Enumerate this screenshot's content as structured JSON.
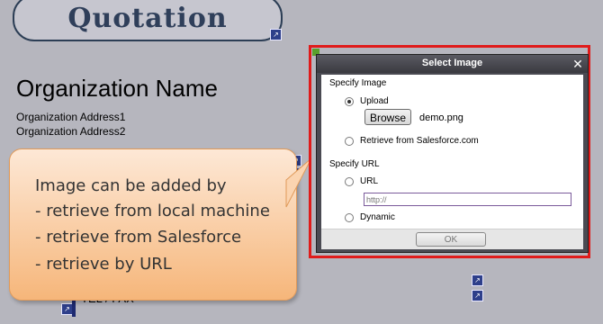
{
  "document": {
    "title": "Quotation",
    "org_name": "Organization Name",
    "org_address_1": "Organization Address1",
    "org_address_2": "Organization Address2",
    "tel_fax": "TEL / FAX"
  },
  "callout": {
    "lines": [
      "Image can be added by",
      "- retrieve from local machine",
      "- retrieve from Salesforce",
      "- retrieve by URL"
    ]
  },
  "dialog": {
    "title": "Select Image",
    "close_glyph": "✕",
    "specify_image_label": "Specify Image",
    "upload_label": "Upload",
    "browse_label": "Browse",
    "file_name": "demo.png",
    "retrieve_sf_label": "Retrieve from Salesforce.com",
    "specify_url_label": "Specify URL",
    "url_label": "URL",
    "url_placeholder": "http://",
    "dynamic_label": "Dynamic",
    "ok_label": "OK"
  },
  "colors": {
    "highlight_frame": "#e01b1b",
    "callout_fill": "#f6b67a",
    "title_color": "#2f3f5a"
  }
}
